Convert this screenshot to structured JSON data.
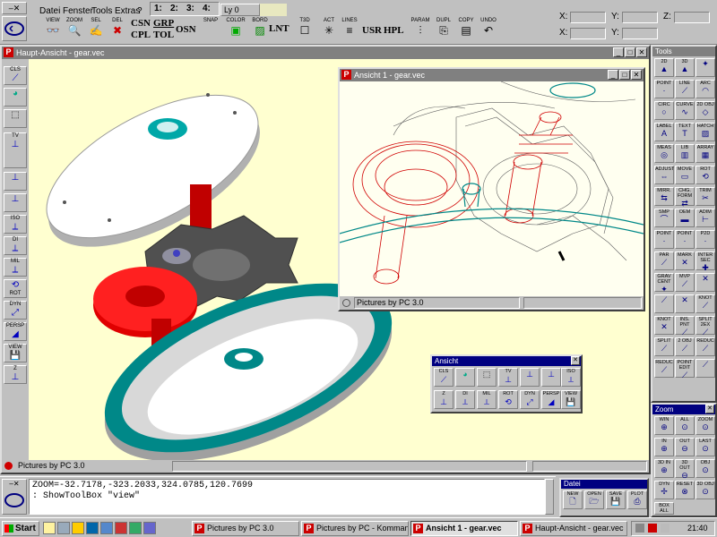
{
  "menu": [
    "Datei",
    "Fenster",
    "Tools",
    "Extras",
    "?"
  ],
  "view_numbers": [
    "1:",
    "2:",
    "3:",
    "4:"
  ],
  "layer": "Ly 0",
  "toolbar_small": [
    {
      "label": "VIEW",
      "icon": "glasses-icon"
    },
    {
      "label": "ZOOM",
      "icon": "magnifier-icon"
    },
    {
      "label": "SEL",
      "icon": "pointer-icon"
    },
    {
      "label": "DEL",
      "icon": "delete-icon"
    }
  ],
  "toolbar_text": {
    "csn": "CSN",
    "cpl": "CPL",
    "grp": "GRP",
    "tol": "TOL",
    "osn": "OSN",
    "snap": "SNAP",
    "color": "COLOR",
    "bord": "BORD",
    "lnt": "LNT",
    "t3d": "T3D",
    "act": "ACT",
    "lines": "LINES",
    "usr": "USR",
    "hpl": "HPL",
    "param": "PARAM",
    "dupl": "DUPL",
    "copy": "COPY",
    "undo": "UNDO"
  },
  "coords": {
    "x": "X:",
    "y": "Y:",
    "z": "Z:"
  },
  "main_window": {
    "title": "Haupt-Ansicht - gear.vec",
    "status": "Pictures by PC 3.0",
    "side_tools": [
      "CLS",
      "",
      "",
      "TV",
      "",
      "",
      "ISO",
      "DI",
      "MIL",
      "ROT",
      "DYN",
      "PERSP",
      "VIEW",
      "Z"
    ]
  },
  "sub_window": {
    "title": "Ansicht 1 - gear.vec",
    "status": "Pictures by PC 3.0"
  },
  "ansicht_toolbox": {
    "title": "Ansicht",
    "tools": [
      "CLS",
      "",
      "",
      "TV",
      "ISO",
      "DI",
      "MIL",
      "ROT",
      "DYN",
      "PERSP",
      "VIEW",
      "Z"
    ]
  },
  "tools_panel": {
    "title": "Tools",
    "items": [
      "2D",
      "3D",
      "",
      "POINT",
      "LINE",
      "ARC",
      "CIRC",
      "CURVE",
      "2D OBJ",
      "LABEL",
      "TEXT",
      "HATCH",
      "MEAS",
      "LIB",
      "ARRAY",
      "ADJUST",
      "MOVE",
      "ROT",
      "MIRR.",
      "CHG. FORM",
      "TRIM",
      "SMP",
      "OEM",
      "ADIM",
      "POINT",
      "POINT",
      "P2D",
      "PAR",
      "MARK",
      "INTER SEC",
      "GRAV CENT",
      "MVP",
      "",
      "",
      "",
      "KNOT",
      "KNOT",
      "INS. PNT",
      "SPLIT 2EX",
      "SPLIT",
      "2 OBJ",
      "REDUC",
      "REDUC",
      "POINT EDIT",
      ""
    ]
  },
  "zoom_panel": {
    "title": "Zoom",
    "items": [
      "WIN",
      "ALL",
      "ZOOM",
      "IN",
      "OUT",
      "LAST",
      "3D IN",
      "3D OUT",
      "OBJ",
      "DYN",
      "RESET",
      "3D OBJ",
      "BOX ALL"
    ]
  },
  "command": {
    "line1": "ZOOM=-32.7178,-323.2033,324.0785,120.7699",
    "line2": ": ShowToolBox \"view\""
  },
  "datei_panel": {
    "title": "Datei",
    "items": [
      "NEW",
      "OPEN",
      "SAVE",
      "PLOT"
    ]
  },
  "taskbar": {
    "start": "Start",
    "tasks": [
      "Pictures by PC 3.0",
      "Pictures by PC - Komman...",
      "Ansicht 1 - gear.vec",
      "Haupt-Ansicht - gear.vec"
    ],
    "active_index": 2,
    "clock": "21:40"
  },
  "colors": {
    "title_active": "#000080",
    "title_inactive": "#808080",
    "canvas_main": "#ffffd0",
    "canvas_sub": "#fffff0",
    "red": "#e00000",
    "teal": "#00a0a0"
  }
}
